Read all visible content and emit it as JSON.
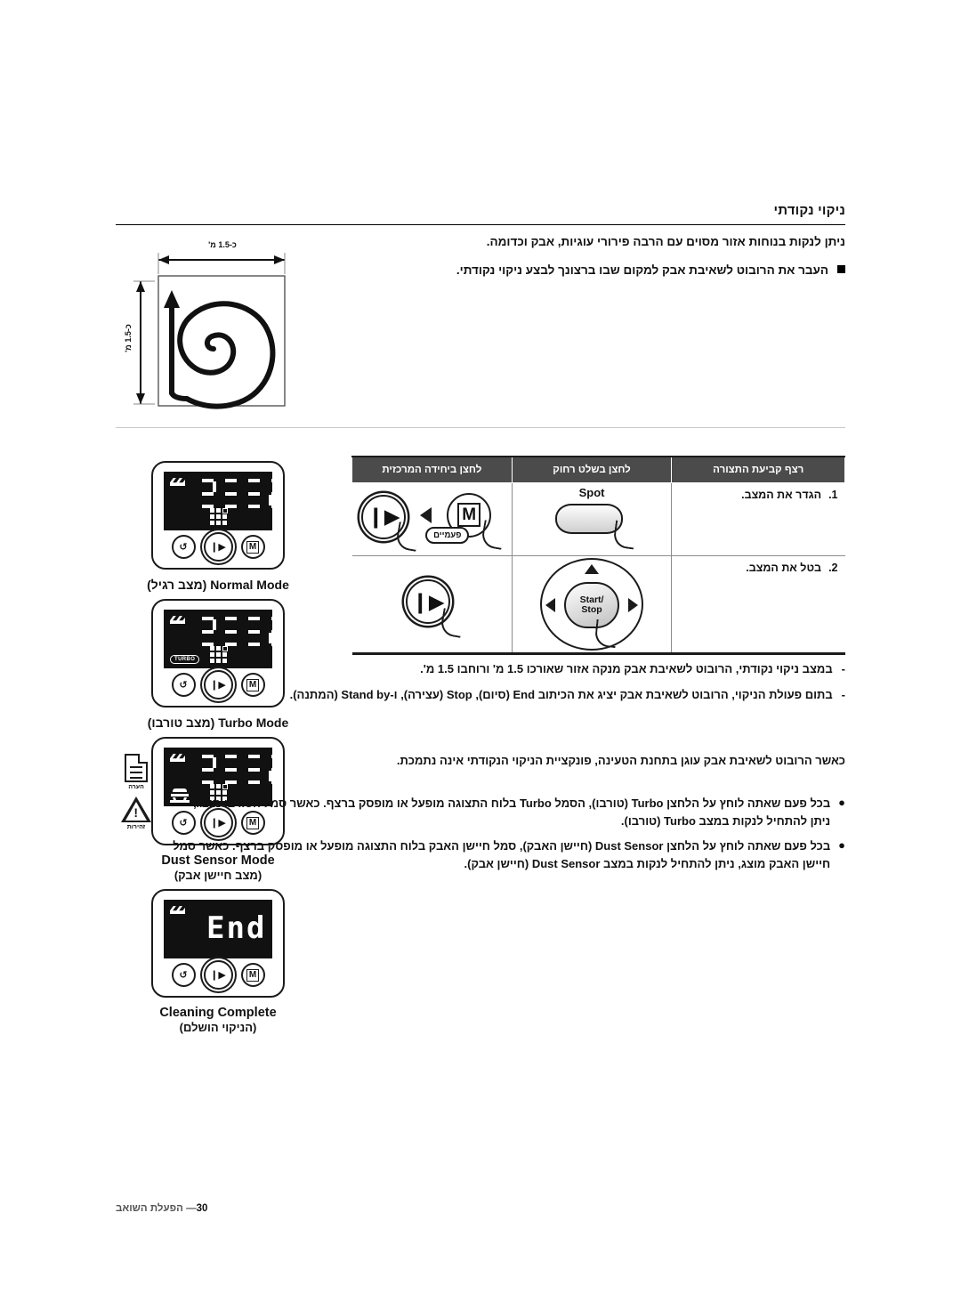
{
  "page": {
    "section_title": "ניקוי נקודתי",
    "intro_paragraph": "ניתן לנקות בנוחות אזור מסוים עם הרבה פירורי עוגיות, אבק וכדומה.",
    "intro_bullet": "העבר את הרובוט לשאיבת אבק למקום שבו ברצונך לבצע ניקוי נקודתי."
  },
  "diagram": {
    "width_label": "כ-1.5 מ'",
    "height_label": "כ-1.5 מ'",
    "shape": "spiral-path-icon"
  },
  "panels": [
    {
      "display_type": "segments",
      "battery_icon": "battery-icon",
      "grid_icon": "grid-dots-icon",
      "badge": "",
      "badge_icon": "",
      "screen_text": "",
      "buttons": [
        "M",
        "⏯",
        "↺"
      ],
      "label_en": "Normal Mode",
      "label_he": "(מצב רגיל)"
    },
    {
      "display_type": "segments",
      "battery_icon": "battery-icon",
      "grid_icon": "grid-dots-icon",
      "badge": "TURBO",
      "badge_icon": "turbo-badge-icon",
      "screen_text": "",
      "buttons": [
        "M",
        "⏯",
        "↺"
      ],
      "label_en": "Turbo Mode",
      "label_he": "(מצב טורבו)"
    },
    {
      "display_type": "segments",
      "battery_icon": "battery-icon",
      "grid_icon": "grid-dots-icon",
      "badge": "",
      "badge_icon": "dust-sensor-icon",
      "screen_text": "",
      "buttons": [
        "M",
        "⏯",
        "↺"
      ],
      "label_en": "Dust Sensor Mode",
      "label_he": "(מצב חיישן אבק)"
    },
    {
      "display_type": "text",
      "battery_icon": "battery-icon",
      "grid_icon": "",
      "badge": "",
      "badge_icon": "",
      "screen_text": "End",
      "buttons": [
        "M",
        "⏯",
        "↺"
      ],
      "label_en": "Cleaning Complete",
      "label_he": "(הניקוי הושלם)"
    }
  ],
  "table": {
    "headers": [
      "לחצן ביחידה המרכזית",
      "לחצן בשלט רחוק",
      "רצף קביעת התצורה"
    ],
    "rows": [
      {
        "number": "1.",
        "text": "הגדר את המצב.",
        "remote_label": "Spot",
        "unit_callout": "פעמיים",
        "unit_buttons": [
          "⏯",
          "M"
        ],
        "remote_art": "spot-button-icon"
      },
      {
        "number": "2.",
        "text": "בטל את המצב.",
        "remote_label": "Start/\nStop",
        "unit_callout": "",
        "unit_buttons": [
          "⏯"
        ],
        "remote_art": "dpad-startstop-icon"
      }
    ]
  },
  "dash_notes": [
    {
      "mark": "-",
      "text": "במצב ניקוי נקודתי, הרובוט לשאיבת אבק מנקה אזור שאורכו 1.5 מ' ורוחבו 1.5 מ'."
    },
    {
      "mark": "-",
      "text": "בתום פעולת הניקוי, הרובוט לשאיבת אבק יציג את הכיתוב End (סיום), Stop (עצירה), ו-Stand by (המתנה)."
    }
  ],
  "note_info": {
    "icon": "document-note-icon",
    "icon_caption": "הערה",
    "text": "כאשר הרובוט לשאיבת אבק עוגן בתחנת הטעינה, פונקציית הניקוי הנקודתי אינה נתמכת."
  },
  "note_caution": {
    "icon": "warning-triangle-icon",
    "icon_caption": "זהירות",
    "bullets": [
      "בכל פעם שאתה לוחץ על הלחצן Turbo (טורבו), הסמל Turbo בלוח התצוגה מופעל או מופסק ברצף. כאשר סמל הטורבו מוצג, ניתן להתחיל לנקות במצב Turbo (טורבו).",
      "בכל פעם שאתה לוחץ על הלחצן Dust Sensor (חיישן האבק), סמל חיישן האבק בלוח התצוגה מופעל או מופסק ברצף. כאשר סמל חיישן האבק מוצג, ניתן להתחיל לנקות במצב Dust Sensor (חיישן אבק)."
    ]
  },
  "footer": {
    "page_number": "30",
    "dash": "—",
    "label": "הפעלת השואב"
  }
}
